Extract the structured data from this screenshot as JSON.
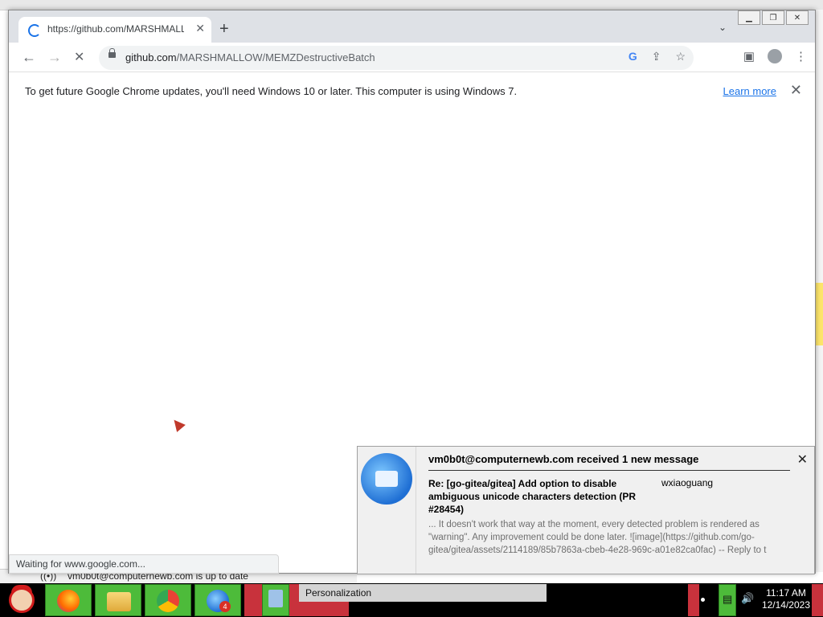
{
  "browser": {
    "tab": {
      "title": "https://github.com/MARSHMALLOW/MEMZDestructiveBatch",
      "close_glyph": "✕"
    },
    "new_tab_glyph": "+",
    "tab_list_glyph": "⌄",
    "window_controls": {
      "minimize": "▁",
      "restore": "❐",
      "close": "✕"
    },
    "nav": {
      "back": "←",
      "forward": "→",
      "stop": "✕"
    },
    "address": {
      "domain": "github.com",
      "path": "/MARSHMALLOW/MEMZDestructiveBatch"
    },
    "omnibox_icons": {
      "google": "G",
      "share": "⇪",
      "bookmark": "☆"
    },
    "toolbar_icons": {
      "side_panel": "▣",
      "menu": "⋮"
    },
    "infobar": {
      "message": "To get future Google Chrome updates, you'll need Windows 10 or later. This computer is using Windows 7.",
      "link": "Learn more",
      "close_glyph": "✕"
    },
    "status": "Waiting for www.google.com..."
  },
  "background": {
    "status_text": "vm0b0t@computernewb.com is up to date",
    "signal_glyph": "((•))"
  },
  "notification": {
    "heading": "vm0b0t@computernewb.com received 1 new message",
    "subject": "Re: [go-gitea/gitea] Add option to disable ambiguous unicode characters detection (PR #28454)",
    "from": "wxiaoguang",
    "body": "... It doesn't work that way at the moment, every detected problem is rendered as \"warning\". Any improvement could be done later. ![image](https://github.com/go-gitea/gitea/assets/2114189/85b7863a-cbeb-4e28-969c-a01e82ca0fac) -- Reply to t",
    "close_glyph": "✕"
  },
  "taskbar": {
    "thunderbird_badge": "4",
    "active_task": "Personalization",
    "clock": {
      "time": "11:17 AM",
      "date": "12/14/2023"
    },
    "tray": {
      "volume": "🔊",
      "network": "▤"
    }
  },
  "colors": {
    "accent": "#1a73e8",
    "taskbar_green": "#4dbb3a",
    "taskbar_red": "#c8323c"
  }
}
